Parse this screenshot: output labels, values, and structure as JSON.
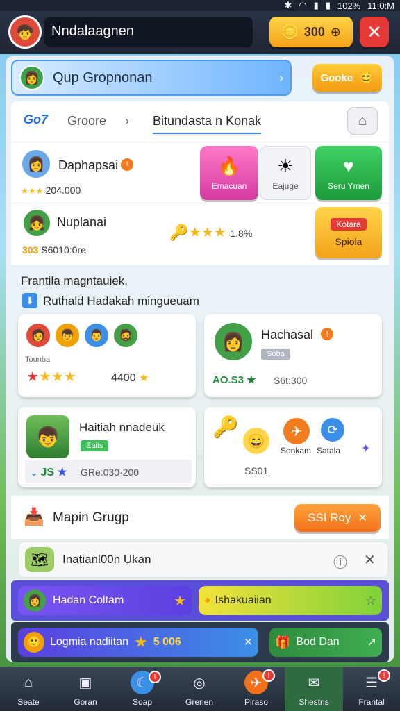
{
  "status_bar": {
    "icons": [
      "asterisk-icon",
      "wifi-icon",
      "signal-icon",
      "signal-icon"
    ],
    "battery": "102%",
    "time": "11:0:M"
  },
  "header": {
    "title": "Nndalaagnen",
    "coins": "300",
    "close_icon": "close-icon"
  },
  "group_banner": {
    "title": "Qup Gropnonan",
    "action": "Gooke"
  },
  "breadcrumb": {
    "logo": "Go7",
    "first": "Groore",
    "second": "Bitundasta n Konak"
  },
  "players": [
    {
      "name": "Daphapsai",
      "rating": "204.000",
      "tags": [
        "Emacuan",
        "Eajuge"
      ],
      "cta": "Seru Ymen"
    },
    {
      "name": "Nuplanai",
      "rating": "S6010:0re",
      "score_label": "303",
      "stars_value": "1.8%",
      "cta_top": "Kotara",
      "cta_bottom": "Spiola"
    }
  ],
  "section_title": "Frantila magntauiek.",
  "section_subtitle": "Ruthald Hadakah mingueuam",
  "cards": {
    "team": {
      "label": "Tounba",
      "score": "4400"
    },
    "profile": {
      "name": "Hachasal",
      "tag": "Soba",
      "score_a": "AO.S3",
      "score_b": "S6t:300"
    },
    "match": {
      "title": "Haitiah nnadeuk",
      "tag": "Eaits",
      "left": "JS",
      "right": "GRe:030·200"
    },
    "rewards": {
      "labels": [
        "Sonkam",
        "Satala"
      ],
      "bottom": "SS01"
    }
  },
  "map_group": {
    "title": "Mapin Grugp",
    "action": "SSI Roy"
  },
  "notification": {
    "text": "Inatianl00n Ukan"
  },
  "action_rows": [
    {
      "left": "Hadan Coltam",
      "right": "Ishakuaiian"
    },
    {
      "left": "Logmia nadiitan",
      "middle": "5 006",
      "right": "Bod Dan"
    }
  ],
  "tabs": [
    "Seate",
    "Goran",
    "Soap",
    "Grenen",
    "Piraso",
    "Shestns",
    "Frantal"
  ],
  "colors": {
    "accent_orange": "#f7931e",
    "accent_green": "#2db84d",
    "accent_red": "#e53935",
    "accent_purple": "#6a4ee8"
  }
}
